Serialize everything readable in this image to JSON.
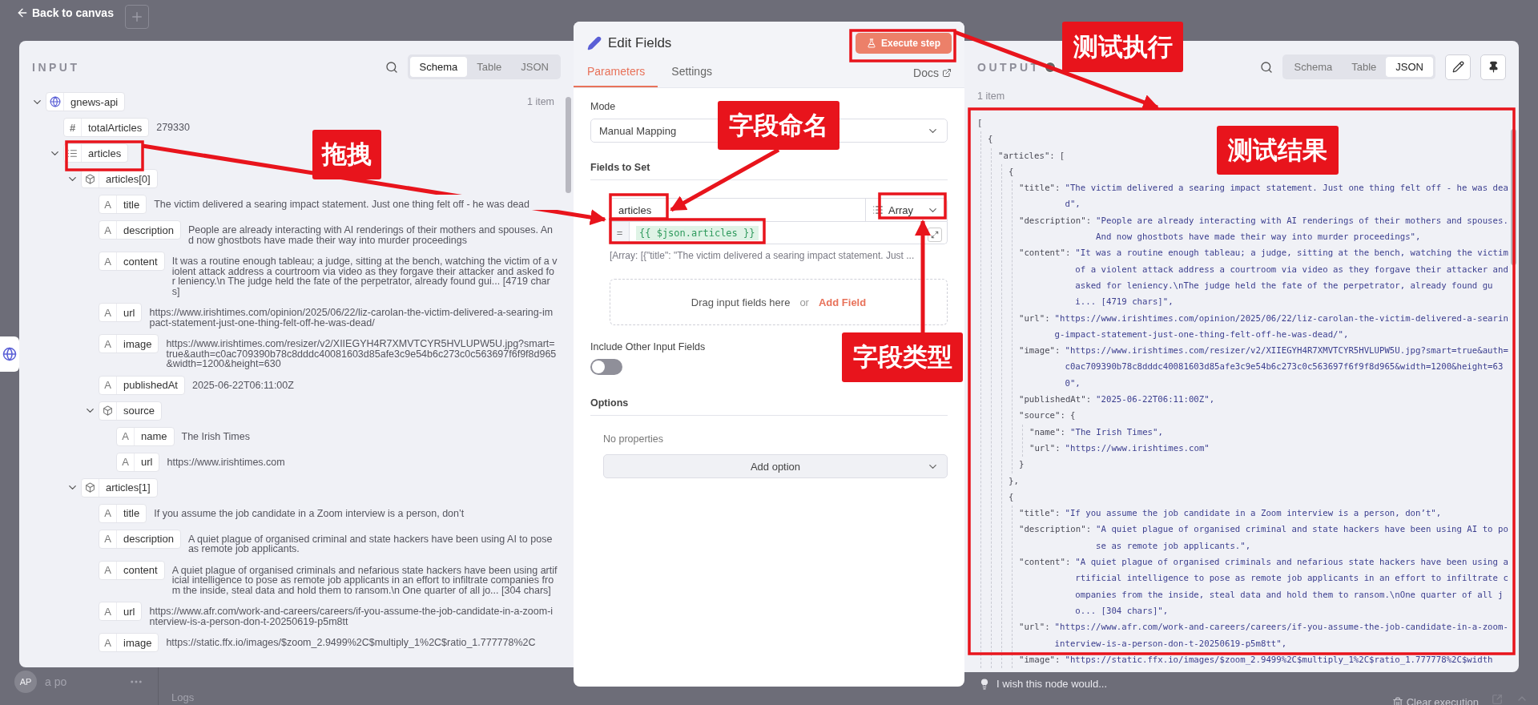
{
  "top_bar": {
    "back_label": "Back to canvas"
  },
  "input_panel": {
    "title": "INPUT",
    "view_tabs": [
      {
        "label": "Schema",
        "selected": true
      },
      {
        "label": "Table",
        "selected": false
      },
      {
        "label": "JSON",
        "selected": false
      }
    ],
    "tree": [
      {
        "kind": "node",
        "key": "gnews-api",
        "count": "1 item",
        "expanded": true,
        "children": [
          {
            "kind": "number",
            "glyph": "#",
            "key": "totalArticles",
            "value": "279330"
          },
          {
            "kind": "array",
            "key": "articles",
            "expanded": true,
            "children": [
              {
                "kind": "object",
                "key": "articles[0]",
                "expanded": true,
                "children": [
                  {
                    "kind": "string",
                    "glyph": "A",
                    "key": "title",
                    "value": "The victim delivered a searing impact statement. Just one thing felt off - he was dead"
                  },
                  {
                    "kind": "string",
                    "glyph": "A",
                    "key": "description",
                    "value": "People are already interacting with AI renderings of their mothers and spouses. And now ghostbots have made their way into murder proceedings"
                  },
                  {
                    "kind": "string",
                    "glyph": "A",
                    "key": "content",
                    "value": "It was a routine enough tableau; a judge, sitting at the bench, watching the victim of a violent attack address a courtroom via video as they forgave their attacker and asked for leniency.\\n The judge held the fate of the perpetrator, already found gui... [4719 chars]"
                  },
                  {
                    "kind": "string",
                    "glyph": "A",
                    "key": "url",
                    "value": "https://www.irishtimes.com/opinion/2025/06/22/liz-carolan-the-victim-delivered-a-searing-impact-statement-just-one-thing-felt-off-he-was-dead/"
                  },
                  {
                    "kind": "string",
                    "glyph": "A",
                    "key": "image",
                    "value": "https://www.irishtimes.com/resizer/v2/XIIEGYH4R7XMVTCYR5HVLUPW5U.jpg?smart=true&auth=c0ac709390b78c8dddc40081603d85afe3c9e54b6c273c0c563697f6f9f8d965&width=1200&height=630"
                  },
                  {
                    "kind": "string",
                    "glyph": "A",
                    "key": "publishedAt",
                    "value": "2025-06-22T06:11:00Z"
                  },
                  {
                    "kind": "object",
                    "key": "source",
                    "expanded": true,
                    "children": [
                      {
                        "kind": "string",
                        "glyph": "A",
                        "key": "name",
                        "value": "The Irish Times"
                      },
                      {
                        "kind": "string",
                        "glyph": "A",
                        "key": "url",
                        "value": "https://www.irishtimes.com"
                      }
                    ]
                  }
                ]
              },
              {
                "kind": "object",
                "key": "articles[1]",
                "expanded": true,
                "children": [
                  {
                    "kind": "string",
                    "glyph": "A",
                    "key": "title",
                    "value": "If you assume the job candidate in a Zoom interview is a person, don’t"
                  },
                  {
                    "kind": "string",
                    "glyph": "A",
                    "key": "description",
                    "value": "A quiet plague of organised criminal and state hackers have been using AI to pose as remote job applicants."
                  },
                  {
                    "kind": "string",
                    "glyph": "A",
                    "key": "content",
                    "value": "A quiet plague of organised criminals and nefarious state hackers have been using artificial intelligence to pose as remote job applicants in an effort to infiltrate companies from the inside, steal data and hold them to ransom.\\n One quarter of all jo... [304 chars]"
                  },
                  {
                    "kind": "string",
                    "glyph": "A",
                    "key": "url",
                    "value": "https://www.afr.com/work-and-careers/careers/if-you-assume-the-job-candidate-in-a-zoom-interview-is-a-person-don-t-20250619-p5m8tt"
                  },
                  {
                    "kind": "string",
                    "glyph": "A",
                    "key": "image",
                    "value": "https://static.ffx.io/images/$zoom_2.9499%2C$multiply_1%2C$ratio_1.777778%2C"
                  }
                ]
              }
            ]
          }
        ]
      }
    ]
  },
  "edit_panel": {
    "title": "Edit Fields",
    "execute_button": "Execute step",
    "tabs": [
      {
        "label": "Parameters",
        "selected": true
      },
      {
        "label": "Settings",
        "selected": false
      }
    ],
    "docs_link": "Docs",
    "mode": {
      "label": "Mode",
      "value": "Manual Mapping"
    },
    "fields_section": "Fields to Set",
    "field": {
      "name": "articles",
      "type": "Array",
      "equals": "=",
      "expression": "{{ $json.articles }}",
      "preview": "[Array: [{\"title\": \"The victim delivered a searing impact statement. Just ..."
    },
    "drop_zone": {
      "text": "Drag input fields here",
      "or": "or",
      "action": "Add Field"
    },
    "include_other": {
      "label": "Include Other Input Fields",
      "on": false
    },
    "options": {
      "label": "Options",
      "empty": "No properties",
      "add_button": "Add option"
    }
  },
  "output_panel": {
    "title": "OUTPUT",
    "success": true,
    "view_tabs": [
      {
        "label": "Schema",
        "selected": false
      },
      {
        "label": "Table",
        "selected": false
      },
      {
        "label": "JSON",
        "selected": true
      }
    ],
    "count": "1 item",
    "json": {
      "open": "[",
      "children": [
        {
          "open": "{",
          "children": [
            {
              "key": "\"articles\":",
              "open": "[",
              "children": [
                {
                  "open": "{",
                  "close": "},",
                  "children": [
                    {
                      "key": "\"title\":",
                      "value": "\"The victim delivered a searing impact statement. Just one thing felt off - he was dead\","
                    },
                    {
                      "key": "\"description\":",
                      "value": "\"People are already interacting with AI renderings of their mothers and spouses. And now ghostbots have made their way into murder proceedings\","
                    },
                    {
                      "key": "\"content\":",
                      "value": "\"It was a routine enough tableau; a judge, sitting at the bench, watching the victim of a violent attack address a courtroom via video as they forgave their attacker and asked for leniency.\\nThe judge held the fate of the perpetrator, already found gui... [4719 chars]\","
                    },
                    {
                      "key": "\"url\":",
                      "value": "\"https://www.irishtimes.com/opinion/2025/06/22/liz-carolan-the-victim-delivered-a-searing-impact-statement-just-one-thing-felt-off-he-was-dead/\","
                    },
                    {
                      "key": "\"image\":",
                      "value": "\"https://www.irishtimes.com/resizer/v2/XIIEGYH4R7XMVTCYR5HVLUPW5U.jpg?smart=true&auth=c0ac709390b78c8dddc40081603d85afe3c9e54b6c273c0c563697f6f9f8d965&width=1200&height=630\","
                    },
                    {
                      "key": "\"publishedAt\":",
                      "value": "\"2025-06-22T06:11:00Z\","
                    },
                    {
                      "key": "\"source\":",
                      "open": "{",
                      "close": "}",
                      "children": [
                        {
                          "key": "\"name\":",
                          "value": "\"The Irish Times\","
                        },
                        {
                          "key": "\"url\":",
                          "value": "\"https://www.irishtimes.com\""
                        }
                      ]
                    }
                  ]
                },
                {
                  "open": "{",
                  "children": [
                    {
                      "key": "\"title\":",
                      "value": "\"If you assume the job candidate in a Zoom interview is a person, don’t\","
                    },
                    {
                      "key": "\"description\":",
                      "value": "\"A quiet plague of organised criminal and state hackers have been using AI to pose as remote job applicants.\","
                    },
                    {
                      "key": "\"content\":",
                      "value": "\"A quiet plague of organised criminals and nefarious state hackers have been using artificial intelligence to pose as remote job applicants in an effort to infiltrate companies from the inside, steal data and hold them to ransom.\\nOne quarter of all jo... [304 chars]\","
                    },
                    {
                      "key": "\"url\":",
                      "value": "\"https://www.afr.com/work-and-careers/careers/if-you-assume-the-job-candidate-in-a-zoom-interview-is-a-person-don-t-20250619-p5m8tt\","
                    },
                    {
                      "key": "\"image\":",
                      "value": "\"https://static.ffx.io/images/$zoom_2.9499%2C$multiply_1%2C$ratio_1.777778%2C$width"
                    }
                  ]
                }
              ]
            }
          ]
        }
      ]
    }
  },
  "feedback": "I wish this node would...",
  "sidebar_user": {
    "initials": "AP",
    "name": "a po"
  },
  "logs_label": "Logs",
  "clear_execution": "Clear execution",
  "annotations": [
    {
      "label": "拖拽"
    },
    {
      "label": "字段命名"
    },
    {
      "label": "字段类型"
    },
    {
      "label": "测试执行"
    },
    {
      "label": "测试结果"
    }
  ]
}
